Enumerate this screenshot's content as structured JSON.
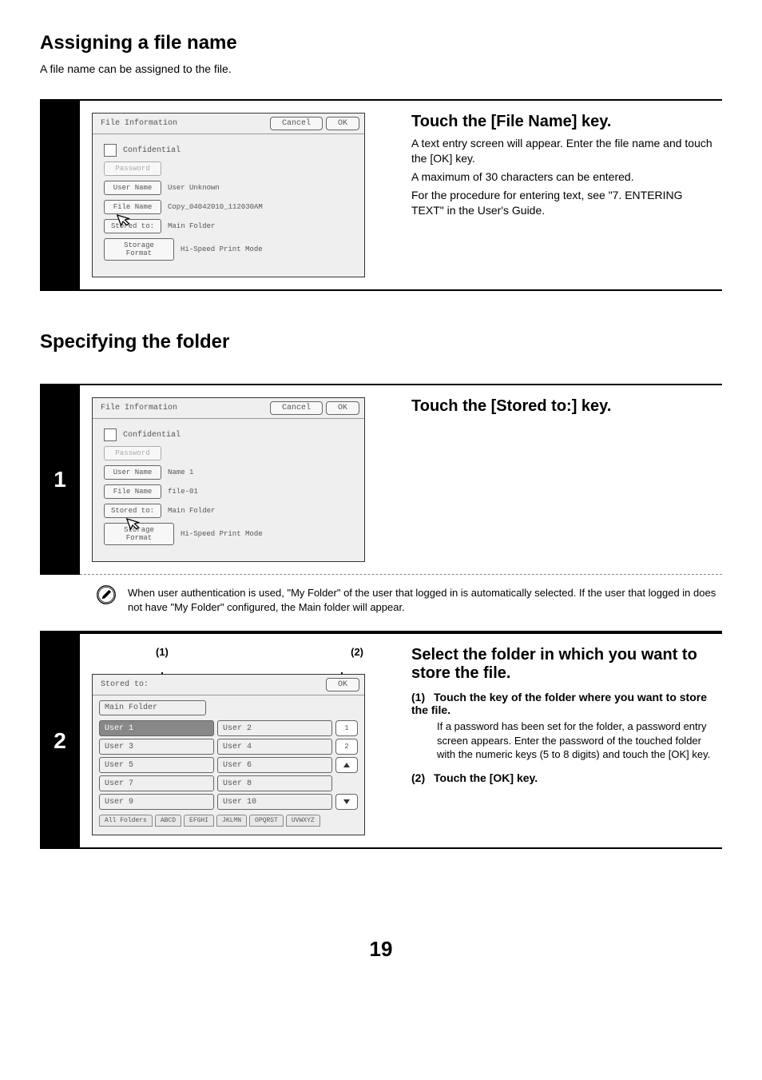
{
  "section1": {
    "title": "Assigning a file name",
    "desc": "A file name can be assigned to the file."
  },
  "step1": {
    "title": "Touch the [File Name] key.",
    "p1": "A text entry screen will appear. Enter the file name and touch the [OK] key.",
    "p2": "A maximum of 30 characters can be entered.",
    "p3": "For the procedure for entering text, see \"7. ENTERING TEXT\" in the User's Guide."
  },
  "panel1": {
    "title": "File Information",
    "cancel": "Cancel",
    "ok": "OK",
    "confidential": "Confidential",
    "password": "Password",
    "userNameLabel": "User Name",
    "userNameValue": "User Unknown",
    "fileNameLabel": "File Name",
    "fileNameValue": "Copy_04042010_112030AM",
    "storedToLabel": "Stored to:",
    "storedToValue": "Main Folder",
    "storageFormatLabel": "Storage Format",
    "storageFormatValue": "Hi-Speed Print Mode"
  },
  "section2": {
    "title": "Specifying the folder"
  },
  "step2_1": {
    "title": "Touch the [Stored to:] key."
  },
  "panel2": {
    "title": "File Information",
    "cancel": "Cancel",
    "ok": "OK",
    "confidential": "Confidential",
    "password": "Password",
    "userNameLabel": "User Name",
    "userNameValue": "Name 1",
    "fileNameLabel": "File Name",
    "fileNameValue": "file-01",
    "storedToLabel": "Stored to:",
    "storedToValue": "Main Folder",
    "storageFormatLabel": "Storage Format",
    "storageFormatValue": "Hi-Speed Print Mode"
  },
  "note1": "When user authentication is used, \"My Folder\" of the user that logged in is automatically selected. If the user that logged in does not have \"My Folder\" configured, the Main folder will appear.",
  "step2_2": {
    "title": "Select the folder in which you want to store the file.",
    "sub1_num": "(1)",
    "sub1_heading": "Touch the key of the folder where you want to store the file.",
    "sub1_desc": "If a password has been set for the folder, a password entry screen appears. Enter the password of the touched folder with the numeric keys (5 to 8 digits) and touch the [OK] key.",
    "sub2_num": "(2)",
    "sub2_heading": "Touch the [OK] key."
  },
  "panel3": {
    "title": "Stored to:",
    "ok": "OK",
    "mainFolder": "Main Folder",
    "users": [
      "User 1",
      "User 2",
      "User 3",
      "User 4",
      "User 5",
      "User 6",
      "User 7",
      "User 8",
      "User 9",
      "User 10"
    ],
    "page1": "1",
    "page2": "2",
    "tabs": [
      "All Folders",
      "ABCD",
      "EFGHI",
      "JKLMN",
      "OPQRST",
      "UVWXYZ"
    ],
    "anno1": "(1)",
    "anno2": "(2)"
  },
  "stepNumbers": {
    "one": "1",
    "two": "2"
  },
  "pageNumber": "19"
}
